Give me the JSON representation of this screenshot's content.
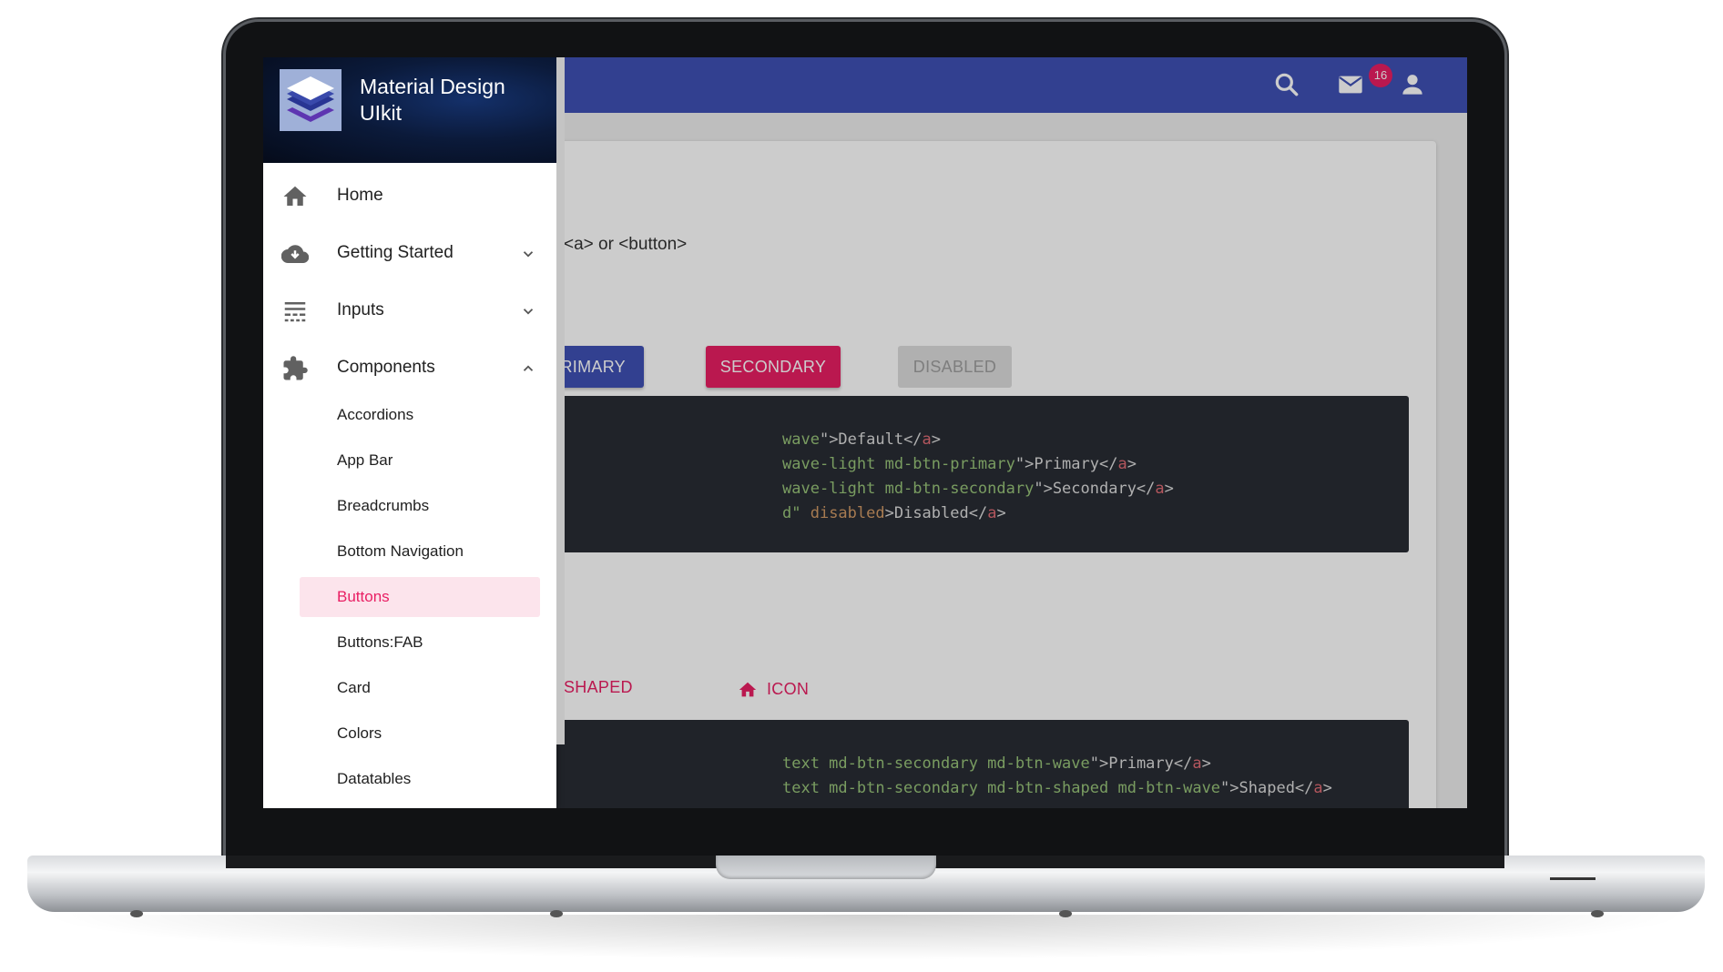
{
  "appbar": {
    "title_fragment": "lkit",
    "badge_count": "16",
    "icons": [
      "search-icon",
      "mail-icon",
      "account-icon"
    ]
  },
  "content": {
    "description_fragment": "<a> or <button>",
    "buttons": {
      "primary": "PRIMARY",
      "secondary": "SECONDARY",
      "disabled": "DISABLED"
    },
    "code_block_1": [
      [
        "wave",
        "\">Default</",
        "a",
        ">"
      ],
      [
        "wave-light md-btn-primary",
        "\">Primary</",
        "a",
        ">"
      ],
      [
        "wave-light md-btn-secondary",
        "\">Secondary</",
        "a",
        ">"
      ],
      [
        "d\" ",
        "disabled",
        ">Disabled</",
        "a",
        ">"
      ]
    ],
    "text_buttons": {
      "shaped": "SHAPED",
      "icon": "ICON"
    },
    "code_block_2": [
      [
        "text md-btn-secondary md-btn-wave",
        "\">Primary</",
        "a",
        ">"
      ],
      [
        "text md-btn-secondary md-btn-shaped md-btn-wave",
        "\">Shaped</",
        "a",
        ">"
      ]
    ]
  },
  "drawer": {
    "title_line1": "Material Design",
    "title_line2": "UIkit",
    "nav": [
      {
        "label": "Home",
        "icon": "home-icon"
      },
      {
        "label": "Getting Started",
        "icon": "cloud-download-icon",
        "chevron": "chevron-down-icon"
      },
      {
        "label": "Inputs",
        "icon": "inputs-icon",
        "chevron": "chevron-down-icon"
      },
      {
        "label": "Components",
        "icon": "puzzle-icon",
        "chevron": "chevron-up-icon"
      }
    ],
    "sub_items": [
      "Accordions",
      "App Bar",
      "Breadcrumbs",
      "Bottom Navigation",
      "Buttons",
      "Buttons:FAB",
      "Card",
      "Colors",
      "Datatables"
    ],
    "active_item": "Buttons"
  },
  "colors": {
    "primary": "#3f51b5",
    "secondary": "#e91e63",
    "active_bg": "#fce4ec"
  }
}
